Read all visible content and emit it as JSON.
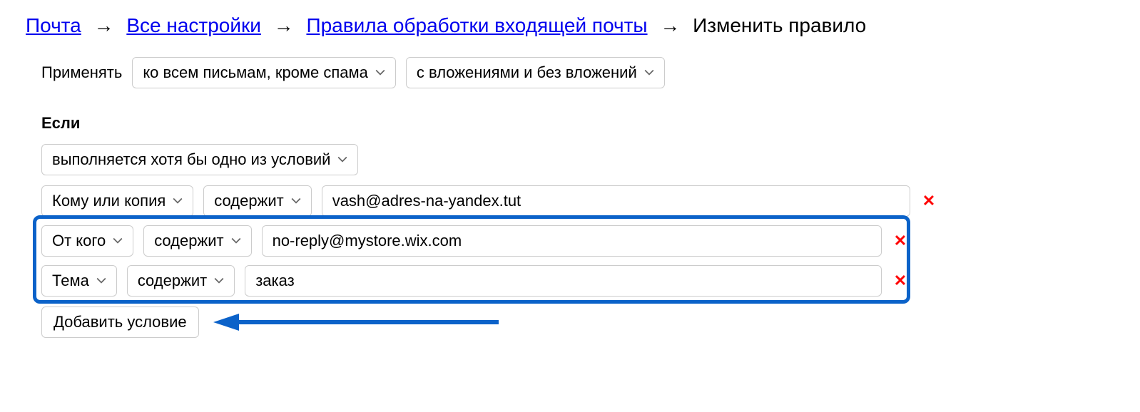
{
  "breadcrumb": {
    "items": [
      {
        "label": "Почта",
        "link": true
      },
      {
        "label": "Все настройки",
        "link": true
      },
      {
        "label": "Правила обработки входящей почты",
        "link": true
      },
      {
        "label": "Изменить правило",
        "link": false
      }
    ],
    "separator": "→"
  },
  "apply": {
    "label": "Применять",
    "scope_selector": "ко всем письмам, кроме спама",
    "attachment_selector": "с вложениями и без вложений"
  },
  "if": {
    "label": "Если",
    "match_selector": "выполняется хотя бы одно из условий",
    "conditions": [
      {
        "field": "Кому или копия",
        "op": "содержит",
        "value": "vash@adres-na-yandex.tut"
      },
      {
        "field": "От кого",
        "op": "содержит",
        "value": "no-reply@mystore.wix.com"
      },
      {
        "field": "Тема",
        "op": "содержит",
        "value": "заказ"
      }
    ],
    "remove_icon": "✕",
    "add_button": "Добавить условие"
  },
  "annotation": {
    "arrow_color": "#0b62c9"
  }
}
